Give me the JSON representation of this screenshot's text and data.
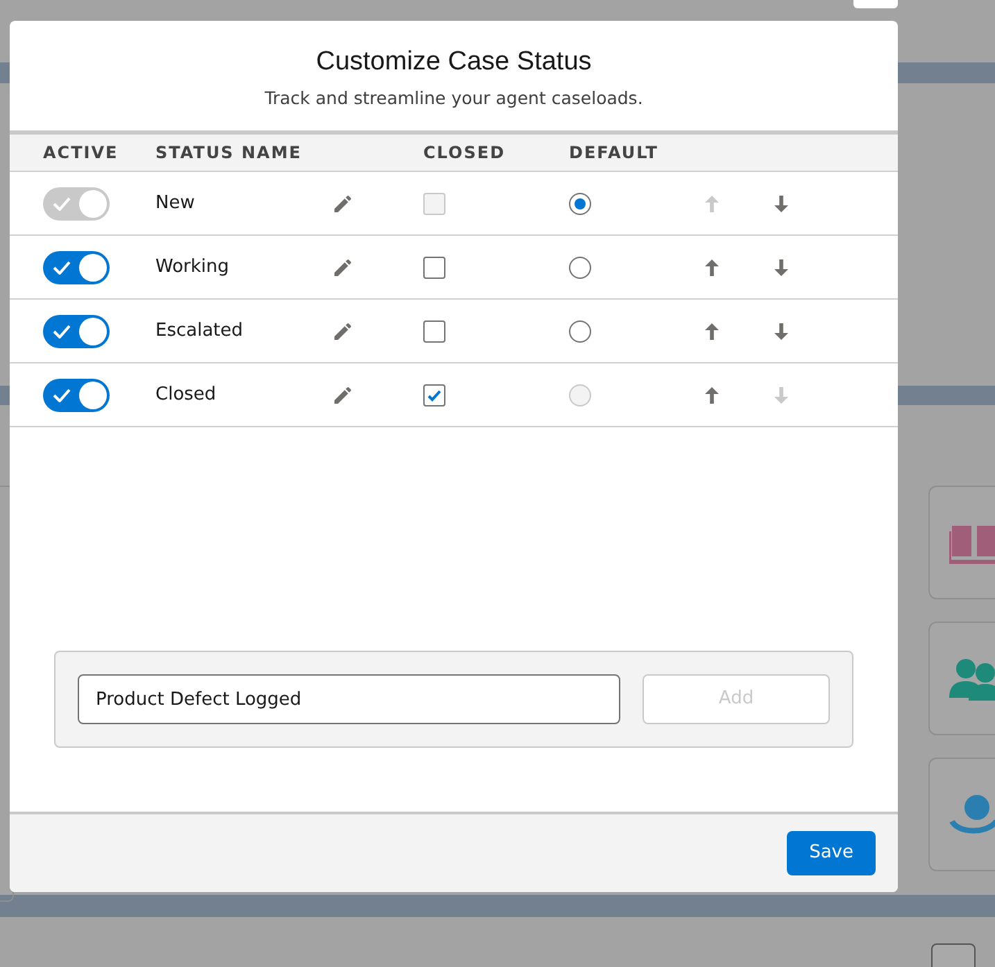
{
  "modal": {
    "title": "Customize Case Status",
    "subtitle": "Track and streamline your agent caseloads.",
    "columns": [
      "ACTIVE",
      "STATUS NAME",
      "CLOSED",
      "DEFAULT"
    ],
    "rows": [
      {
        "active": true,
        "active_disabled": true,
        "name": "New",
        "closed": false,
        "closed_disabled": true,
        "selected": true,
        "default_disabled": false,
        "up_disabled": true,
        "down_disabled": false
      },
      {
        "active": true,
        "active_disabled": false,
        "name": "Working",
        "closed": false,
        "closed_disabled": false,
        "selected": false,
        "default_disabled": false,
        "up_disabled": false,
        "down_disabled": false
      },
      {
        "active": true,
        "active_disabled": false,
        "name": "Escalated",
        "closed": false,
        "closed_disabled": false,
        "selected": false,
        "default_disabled": false,
        "up_disabled": false,
        "down_disabled": false
      },
      {
        "active": true,
        "active_disabled": false,
        "name": "Closed",
        "closed": true,
        "closed_disabled": false,
        "selected": false,
        "default_disabled": true,
        "up_disabled": false,
        "down_disabled": true
      }
    ],
    "new_status": {
      "value": "Product Defect Logged",
      "add_label": "Add",
      "add_disabled": true
    },
    "save_label": "Save"
  }
}
